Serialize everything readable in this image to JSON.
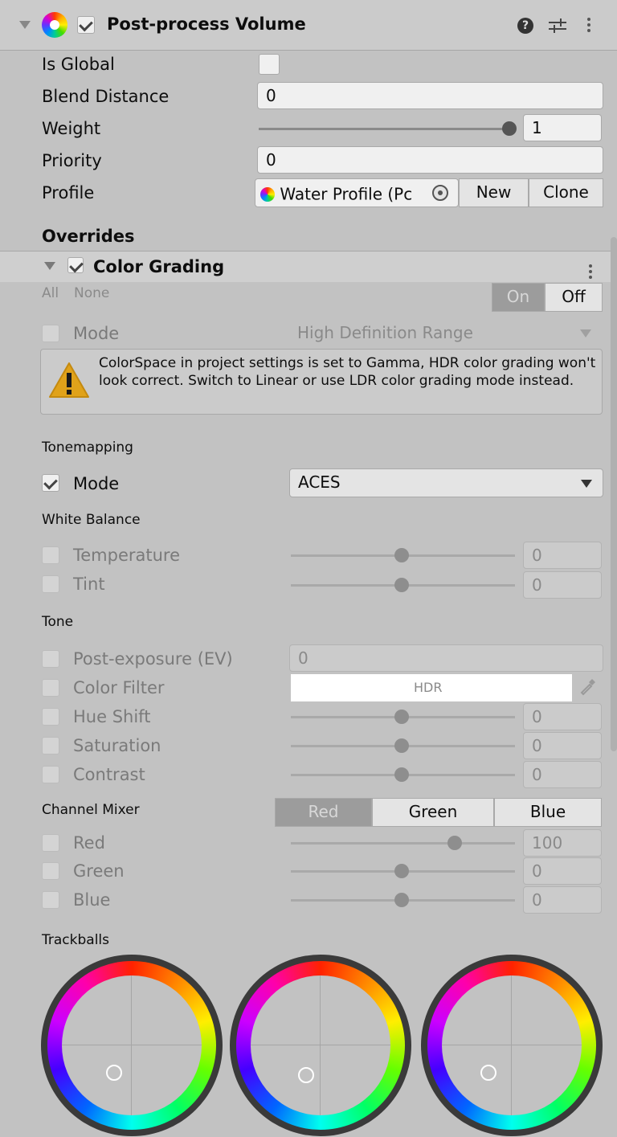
{
  "component": {
    "title": "Post-process Volume"
  },
  "props": {
    "is_global_label": "Is Global",
    "blend_distance_label": "Blend Distance",
    "blend_distance_value": "0",
    "weight_label": "Weight",
    "weight_value": "1",
    "weight_fraction": 1.0,
    "priority_label": "Priority",
    "priority_value": "0",
    "profile_label": "Profile",
    "profile_value": "Water Profile (Pc",
    "new_label": "New",
    "clone_label": "Clone"
  },
  "overrides": {
    "heading": "Overrides",
    "effect_title": "Color Grading",
    "all_label": "All",
    "none_label": "None",
    "on_label": "On",
    "off_label": "Off"
  },
  "grading": {
    "mode_label": "Mode",
    "mode_value": "High Definition Range",
    "warning": "ColorSpace in project settings is set to Gamma, HDR color grading won't look correct. Switch to Linear or use LDR color grading mode instead."
  },
  "tonemapping": {
    "heading": "Tonemapping",
    "mode_label": "Mode",
    "mode_value": "ACES"
  },
  "white_balance": {
    "heading": "White Balance",
    "temperature_label": "Temperature",
    "temperature_value": "0",
    "tint_label": "Tint",
    "tint_value": "0"
  },
  "tone": {
    "heading": "Tone",
    "post_exposure_label": "Post-exposure (EV)",
    "post_exposure_value": "0",
    "color_filter_label": "Color Filter",
    "color_filter_value": "HDR",
    "hue_shift_label": "Hue Shift",
    "hue_shift_value": "0",
    "saturation_label": "Saturation",
    "saturation_value": "0",
    "contrast_label": "Contrast",
    "contrast_value": "0"
  },
  "channel_mixer": {
    "heading": "Channel Mixer",
    "tab_red": "Red",
    "tab_green": "Green",
    "tab_blue": "Blue",
    "red_label": "Red",
    "red_value": "100",
    "green_label": "Green",
    "green_value": "0",
    "blue_label": "Blue",
    "blue_value": "0"
  },
  "trackballs": {
    "heading": "Trackballs"
  },
  "colors": {
    "panel_bg": "#c2c2c2",
    "warning_icon": "#e0a21a",
    "active_segment": "#9c9c9c"
  }
}
